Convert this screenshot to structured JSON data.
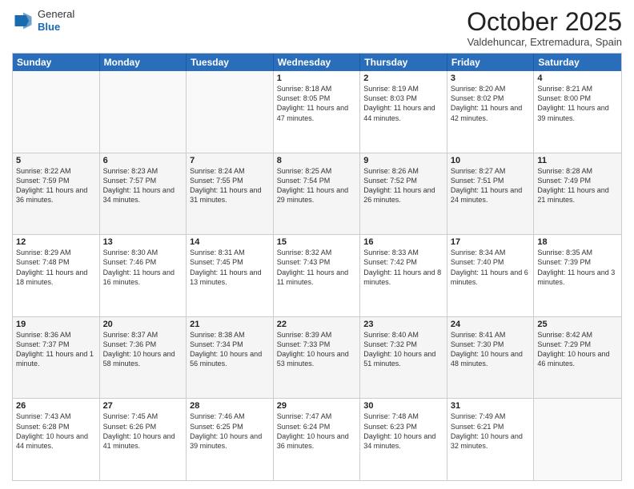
{
  "header": {
    "logo": {
      "general": "General",
      "blue": "Blue"
    },
    "title": "October 2025",
    "location": "Valdehuncar, Extremadura, Spain"
  },
  "calendar": {
    "days": [
      "Sunday",
      "Monday",
      "Tuesday",
      "Wednesday",
      "Thursday",
      "Friday",
      "Saturday"
    ],
    "rows": [
      [
        {
          "day": "",
          "sunrise": "",
          "sunset": "",
          "daylight": "",
          "empty": true
        },
        {
          "day": "",
          "sunrise": "",
          "sunset": "",
          "daylight": "",
          "empty": true
        },
        {
          "day": "",
          "sunrise": "",
          "sunset": "",
          "daylight": "",
          "empty": true
        },
        {
          "day": "1",
          "sunrise": "Sunrise: 8:18 AM",
          "sunset": "Sunset: 8:05 PM",
          "daylight": "Daylight: 11 hours and 47 minutes."
        },
        {
          "day": "2",
          "sunrise": "Sunrise: 8:19 AM",
          "sunset": "Sunset: 8:03 PM",
          "daylight": "Daylight: 11 hours and 44 minutes."
        },
        {
          "day": "3",
          "sunrise": "Sunrise: 8:20 AM",
          "sunset": "Sunset: 8:02 PM",
          "daylight": "Daylight: 11 hours and 42 minutes."
        },
        {
          "day": "4",
          "sunrise": "Sunrise: 8:21 AM",
          "sunset": "Sunset: 8:00 PM",
          "daylight": "Daylight: 11 hours and 39 minutes."
        }
      ],
      [
        {
          "day": "5",
          "sunrise": "Sunrise: 8:22 AM",
          "sunset": "Sunset: 7:59 PM",
          "daylight": "Daylight: 11 hours and 36 minutes."
        },
        {
          "day": "6",
          "sunrise": "Sunrise: 8:23 AM",
          "sunset": "Sunset: 7:57 PM",
          "daylight": "Daylight: 11 hours and 34 minutes."
        },
        {
          "day": "7",
          "sunrise": "Sunrise: 8:24 AM",
          "sunset": "Sunset: 7:55 PM",
          "daylight": "Daylight: 11 hours and 31 minutes."
        },
        {
          "day": "8",
          "sunrise": "Sunrise: 8:25 AM",
          "sunset": "Sunset: 7:54 PM",
          "daylight": "Daylight: 11 hours and 29 minutes."
        },
        {
          "day": "9",
          "sunrise": "Sunrise: 8:26 AM",
          "sunset": "Sunset: 7:52 PM",
          "daylight": "Daylight: 11 hours and 26 minutes."
        },
        {
          "day": "10",
          "sunrise": "Sunrise: 8:27 AM",
          "sunset": "Sunset: 7:51 PM",
          "daylight": "Daylight: 11 hours and 24 minutes."
        },
        {
          "day": "11",
          "sunrise": "Sunrise: 8:28 AM",
          "sunset": "Sunset: 7:49 PM",
          "daylight": "Daylight: 11 hours and 21 minutes."
        }
      ],
      [
        {
          "day": "12",
          "sunrise": "Sunrise: 8:29 AM",
          "sunset": "Sunset: 7:48 PM",
          "daylight": "Daylight: 11 hours and 18 minutes."
        },
        {
          "day": "13",
          "sunrise": "Sunrise: 8:30 AM",
          "sunset": "Sunset: 7:46 PM",
          "daylight": "Daylight: 11 hours and 16 minutes."
        },
        {
          "day": "14",
          "sunrise": "Sunrise: 8:31 AM",
          "sunset": "Sunset: 7:45 PM",
          "daylight": "Daylight: 11 hours and 13 minutes."
        },
        {
          "day": "15",
          "sunrise": "Sunrise: 8:32 AM",
          "sunset": "Sunset: 7:43 PM",
          "daylight": "Daylight: 11 hours and 11 minutes."
        },
        {
          "day": "16",
          "sunrise": "Sunrise: 8:33 AM",
          "sunset": "Sunset: 7:42 PM",
          "daylight": "Daylight: 11 hours and 8 minutes."
        },
        {
          "day": "17",
          "sunrise": "Sunrise: 8:34 AM",
          "sunset": "Sunset: 7:40 PM",
          "daylight": "Daylight: 11 hours and 6 minutes."
        },
        {
          "day": "18",
          "sunrise": "Sunrise: 8:35 AM",
          "sunset": "Sunset: 7:39 PM",
          "daylight": "Daylight: 11 hours and 3 minutes."
        }
      ],
      [
        {
          "day": "19",
          "sunrise": "Sunrise: 8:36 AM",
          "sunset": "Sunset: 7:37 PM",
          "daylight": "Daylight: 11 hours and 1 minute."
        },
        {
          "day": "20",
          "sunrise": "Sunrise: 8:37 AM",
          "sunset": "Sunset: 7:36 PM",
          "daylight": "Daylight: 10 hours and 58 minutes."
        },
        {
          "day": "21",
          "sunrise": "Sunrise: 8:38 AM",
          "sunset": "Sunset: 7:34 PM",
          "daylight": "Daylight: 10 hours and 56 minutes."
        },
        {
          "day": "22",
          "sunrise": "Sunrise: 8:39 AM",
          "sunset": "Sunset: 7:33 PM",
          "daylight": "Daylight: 10 hours and 53 minutes."
        },
        {
          "day": "23",
          "sunrise": "Sunrise: 8:40 AM",
          "sunset": "Sunset: 7:32 PM",
          "daylight": "Daylight: 10 hours and 51 minutes."
        },
        {
          "day": "24",
          "sunrise": "Sunrise: 8:41 AM",
          "sunset": "Sunset: 7:30 PM",
          "daylight": "Daylight: 10 hours and 48 minutes."
        },
        {
          "day": "25",
          "sunrise": "Sunrise: 8:42 AM",
          "sunset": "Sunset: 7:29 PM",
          "daylight": "Daylight: 10 hours and 46 minutes."
        }
      ],
      [
        {
          "day": "26",
          "sunrise": "Sunrise: 7:43 AM",
          "sunset": "Sunset: 6:28 PM",
          "daylight": "Daylight: 10 hours and 44 minutes."
        },
        {
          "day": "27",
          "sunrise": "Sunrise: 7:45 AM",
          "sunset": "Sunset: 6:26 PM",
          "daylight": "Daylight: 10 hours and 41 minutes."
        },
        {
          "day": "28",
          "sunrise": "Sunrise: 7:46 AM",
          "sunset": "Sunset: 6:25 PM",
          "daylight": "Daylight: 10 hours and 39 minutes."
        },
        {
          "day": "29",
          "sunrise": "Sunrise: 7:47 AM",
          "sunset": "Sunset: 6:24 PM",
          "daylight": "Daylight: 10 hours and 36 minutes."
        },
        {
          "day": "30",
          "sunrise": "Sunrise: 7:48 AM",
          "sunset": "Sunset: 6:23 PM",
          "daylight": "Daylight: 10 hours and 34 minutes."
        },
        {
          "day": "31",
          "sunrise": "Sunrise: 7:49 AM",
          "sunset": "Sunset: 6:21 PM",
          "daylight": "Daylight: 10 hours and 32 minutes."
        },
        {
          "day": "",
          "sunrise": "",
          "sunset": "",
          "daylight": "",
          "empty": true
        }
      ]
    ]
  }
}
